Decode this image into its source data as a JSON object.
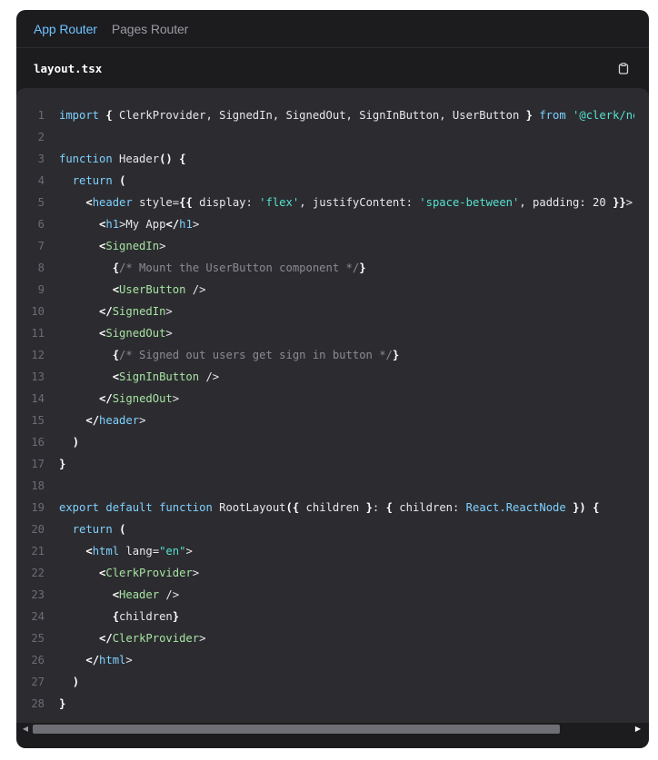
{
  "tabs": [
    {
      "label": "App Router",
      "active": true
    },
    {
      "label": "Pages Router",
      "active": false
    }
  ],
  "file": {
    "name": "layout.tsx",
    "copy_icon": "clipboard-icon"
  },
  "code": {
    "line_numbers": [
      "1",
      "2",
      "3",
      "4",
      "5",
      "6",
      "7",
      "8",
      "9",
      "10",
      "11",
      "12",
      "13",
      "14",
      "15",
      "16",
      "17",
      "18",
      "19",
      "20",
      "21",
      "22",
      "23",
      "24",
      "25",
      "26",
      "27",
      "28"
    ],
    "lines": [
      "import { ClerkProvider, SignedIn, SignedOut, SignInButton, UserButton } from '@clerk/nextjs'",
      "",
      "function Header() {",
      "  return (",
      "    <header style={{ display: 'flex', justifyContent: 'space-between', padding: 20 }}>",
      "      <h1>My App</h1>",
      "      <SignedIn>",
      "        {/* Mount the UserButton component */}",
      "        <UserButton />",
      "      </SignedIn>",
      "      <SignedOut>",
      "        {/* Signed out users get sign in button */}",
      "        <SignInButton />",
      "      </SignedOut>",
      "    </header>",
      "  )",
      "}",
      "",
      "export default function RootLayout({ children }: { children: React.ReactNode }) {",
      "  return (",
      "    <html lang=\"en\">",
      "      <ClerkProvider>",
      "        <Header />",
      "        {children}",
      "      </ClerkProvider>",
      "    </html>",
      "  )",
      "}"
    ]
  },
  "colors": {
    "accent": "#6ec3ff",
    "panel": "#1c1c1f",
    "code_bg": "#2c2c30",
    "keyword": "#7fd0ff",
    "tag": "#a6e3a1",
    "string": "#55e0cf",
    "comment": "#8a8a92"
  }
}
